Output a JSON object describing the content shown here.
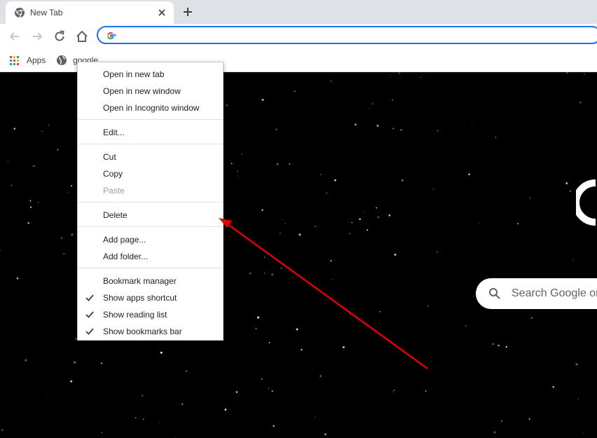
{
  "browser": {
    "tab": {
      "title": "New Tab"
    },
    "omnibox": {
      "value": "",
      "placeholder": ""
    },
    "bookmarks": [
      {
        "label": "Apps",
        "icon": "apps-grid-icon"
      },
      {
        "label": "google",
        "icon": "globe-icon"
      }
    ]
  },
  "context_menu": {
    "items": [
      {
        "label": "Open in new tab",
        "checked": false,
        "disabled": false
      },
      {
        "label": "Open in new window",
        "checked": false,
        "disabled": false
      },
      {
        "label": "Open in Incognito window",
        "checked": false,
        "disabled": false
      },
      {
        "label": "Edit...",
        "checked": false,
        "disabled": false
      },
      {
        "label": "Cut",
        "checked": false,
        "disabled": false
      },
      {
        "label": "Copy",
        "checked": false,
        "disabled": false
      },
      {
        "label": "Paste",
        "checked": false,
        "disabled": true
      },
      {
        "label": "Delete",
        "checked": false,
        "disabled": false
      },
      {
        "label": "Add page...",
        "checked": false,
        "disabled": false
      },
      {
        "label": "Add folder...",
        "checked": false,
        "disabled": false
      },
      {
        "label": "Bookmark manager",
        "checked": false,
        "disabled": false
      },
      {
        "label": "Show apps shortcut",
        "checked": true,
        "disabled": false
      },
      {
        "label": "Show reading list",
        "checked": true,
        "disabled": false
      },
      {
        "label": "Show bookmarks bar",
        "checked": true,
        "disabled": false
      }
    ]
  },
  "ntp": {
    "search_placeholder": "Search Google or"
  },
  "colors": {
    "accent": "#1a73e8",
    "annotation_arrow": "#e00000",
    "background": "#000000"
  }
}
